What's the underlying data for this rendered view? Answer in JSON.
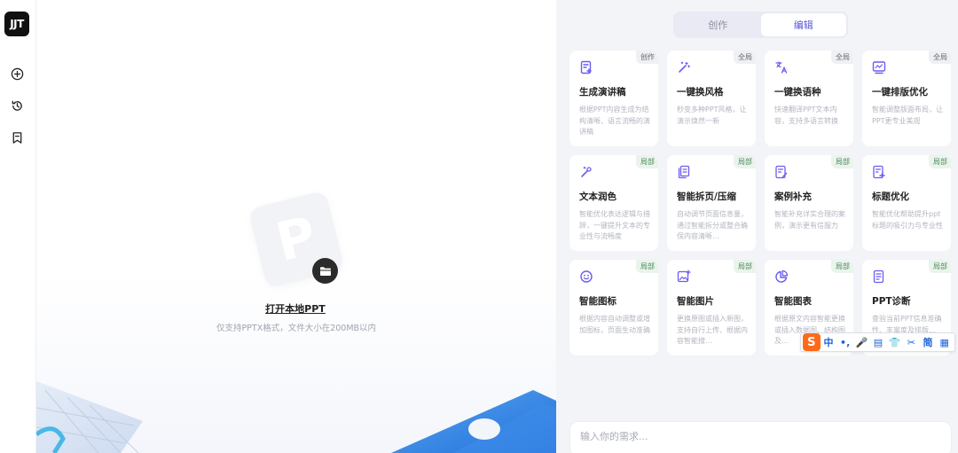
{
  "rail": {
    "logo": "JJT",
    "buttons": [
      "new-icon",
      "history-icon",
      "bookmark-icon"
    ]
  },
  "workspace": {
    "ppt_letter": "P",
    "open_label": "打开本地PPT",
    "hint": "仅支持PPTX格式，文件大小在200MB以内"
  },
  "tabs": [
    {
      "label": "创作",
      "active": false
    },
    {
      "label": "编辑",
      "active": true
    }
  ],
  "cards": [
    {
      "title": "生成演讲稿",
      "tag": "创作",
      "desc": "根据PPT内容生成为结构清晰、语言流畅的演讲稿",
      "icon": "speech-doc-icon"
    },
    {
      "title": "一键换风格",
      "tag": "全局",
      "desc": "秒变多种PPT风格，让演示焕然一新",
      "icon": "magic-wand-icon"
    },
    {
      "title": "一键换语种",
      "tag": "全局",
      "desc": "快速翻译PPT文本内容，支持多语言转换",
      "icon": "translate-icon"
    },
    {
      "title": "一键排版优化",
      "tag": "全局",
      "desc": "智能调整版面布局，让PPT更专业美观",
      "icon": "layout-icon"
    },
    {
      "title": "文本润色",
      "tag": "局部",
      "desc": "智能优化表达逻辑与措辞，一键提升文本的专业性与流畅度",
      "icon": "polish-wand-icon"
    },
    {
      "title": "智能拆页/压缩",
      "tag": "局部",
      "desc": "自动调节页面信息量，通过智能拆分或整合确保内容清晰…",
      "icon": "split-pages-icon"
    },
    {
      "title": "案例补充",
      "tag": "局部",
      "desc": "智能补充详实合理的案例，演示更有信服力",
      "icon": "case-edit-icon"
    },
    {
      "title": "标题优化",
      "tag": "局部",
      "desc": "智能优化帮助提升ppt标题的吸引力与专业性",
      "icon": "title-plus-icon"
    },
    {
      "title": "智能图标",
      "tag": "局部",
      "desc": "根据内容自动调整或增加图标，页面生动准确",
      "icon": "smiley-icon"
    },
    {
      "title": "智能图片",
      "tag": "局部",
      "desc": "更换原图或插入新图，支持自行上传、根据内容智能搜…",
      "icon": "image-plus-icon"
    },
    {
      "title": "智能图表",
      "tag": "局部",
      "desc": "根据原文内容智能更换或插入数据图、结构图及…",
      "icon": "pie-chart-icon"
    },
    {
      "title": "PPT诊断",
      "tag": "局部",
      "desc": "查验当前PPT信息准确性、丰富度及排版…",
      "icon": "diagnose-doc-icon"
    }
  ],
  "input": {
    "placeholder": "输入你的需求..."
  },
  "ime": {
    "logo": "S",
    "items": [
      "中",
      "•,",
      "🎤",
      "▤",
      "👕",
      "✂",
      "简",
      "▦"
    ]
  },
  "colors": {
    "accent": "#5b57d6",
    "icon": "#6a5cf0"
  }
}
